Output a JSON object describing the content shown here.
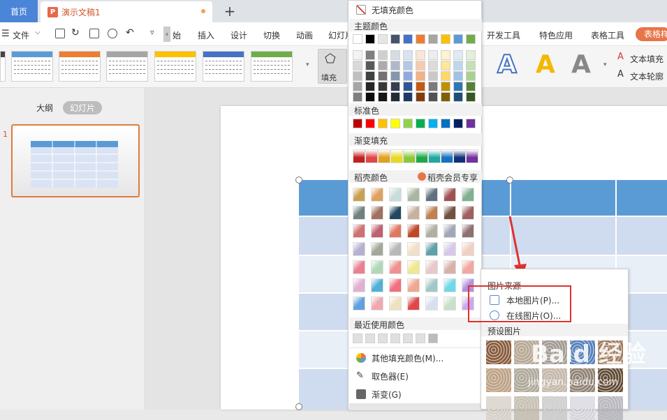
{
  "titlebar": {
    "home_tab": "首页",
    "doc_tab": "演示文稿1",
    "doc_logo": "P",
    "plus": "+"
  },
  "menubar": {
    "file": "文件",
    "items": [
      "始",
      "插入",
      "设计",
      "切换",
      "动画",
      "幻灯片"
    ],
    "right_items": [
      "开发工具",
      "特色应用",
      "表格工具"
    ],
    "table_style_btn": "表格样",
    "arrow_left": "‹"
  },
  "ribbon": {
    "fill_label": "填充",
    "text_fill": "文本填充",
    "text_outline": "文本轮廓",
    "big_letters": [
      "A",
      "A",
      "A"
    ]
  },
  "sidebar": {
    "outline_tab": "大纲",
    "slides_tab": "幻灯片",
    "slide_number": "1"
  },
  "dropdown": {
    "no_fill": "无填充颜色",
    "theme_colors_title": "主题颜色",
    "standard_colors_title": "标准色",
    "gradient_fill_title": "渐变填充",
    "docer_colors_title": "稻壳颜色",
    "docer_member": "稻壳会员专享",
    "recent_colors_title": "最近使用颜色",
    "more_colors": "其他填充颜色(M)...",
    "eyedropper": "取色器(E)",
    "gradient": "渐变(G)",
    "theme_top": [
      "#ffffff",
      "#000000",
      "#e7e6e6",
      "#44546a",
      "#4472c4",
      "#ed7d31",
      "#a5a5a5",
      "#ffc000",
      "#5b9bd5",
      "#70ad47"
    ],
    "standard": [
      "#c00000",
      "#ff0000",
      "#ffc000",
      "#ffff00",
      "#92d050",
      "#00b050",
      "#00b0f0",
      "#0070c0",
      "#002060",
      "#7030a0"
    ],
    "gradient_swatches": [
      "#c0201e",
      "#e04848",
      "#e0a020",
      "#e8d820",
      "#8cc83c",
      "#20a848",
      "#20a8a0",
      "#1870c0",
      "#103078",
      "#7030a0"
    ]
  },
  "submenu": {
    "picture_source": "图片来源",
    "local_picture": "本地图片(P)...",
    "online_picture": "在线图片(O)...",
    "preset_pictures": "预设图片"
  },
  "watermark": {
    "text": "Baid 经验",
    "url": "jingyan.baidu.com"
  }
}
